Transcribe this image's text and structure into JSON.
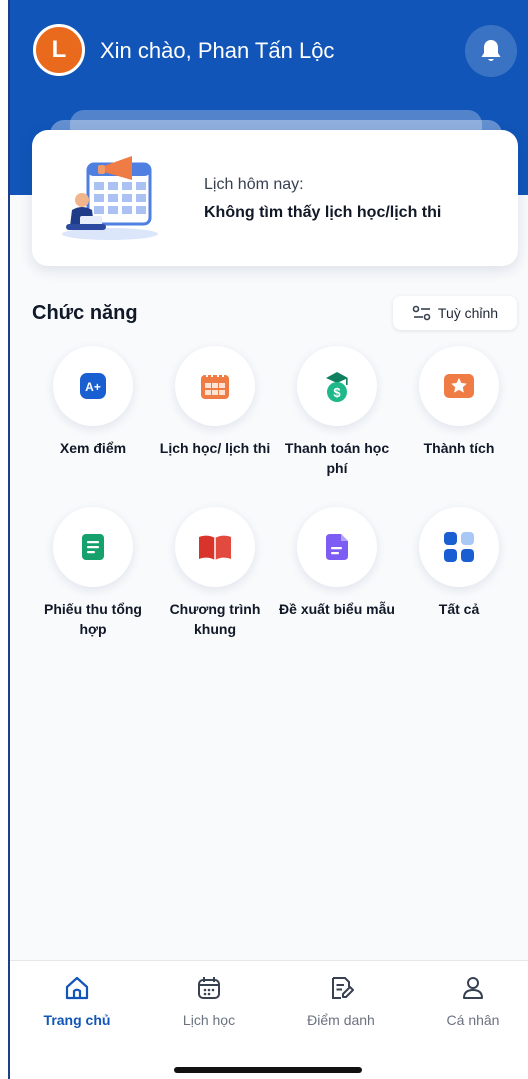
{
  "header": {
    "avatar_initial": "L",
    "greeting": "Xin chào, Phan Tấn Lộc",
    "bell_icon": "bell-icon"
  },
  "schedule_card": {
    "label": "Lịch hôm nay:",
    "value": "Không tìm thấy lịch học/lịch thi"
  },
  "features_section": {
    "title": "Chức năng",
    "customize_label": "Tuỳ chỉnh",
    "items": [
      {
        "label": "Xem điểm",
        "icon": "grade-icon",
        "color": "#1a5fd1"
      },
      {
        "label": "Lịch học/ lịch thi",
        "icon": "calendar-icon",
        "color": "#f07c45"
      },
      {
        "label": "Thanh toán học phí",
        "icon": "tuition-icon",
        "color": "#12a07a"
      },
      {
        "label": "Thành tích",
        "icon": "achievement-icon",
        "color": "#f07c45"
      },
      {
        "label": "Phiếu thu tổng hợp",
        "icon": "receipt-icon",
        "color": "#16a06b"
      },
      {
        "label": "Chương trình khung",
        "icon": "book-icon",
        "color": "#d9342b"
      },
      {
        "label": "Đề xuất biểu mẫu",
        "icon": "form-icon",
        "color": "#7c5cf2"
      },
      {
        "label": "Tất cả",
        "icon": "grid-icon",
        "color": "#1a5fd1"
      }
    ]
  },
  "bottom_nav": {
    "items": [
      {
        "label": "Trang chủ",
        "icon": "home-icon",
        "active": true
      },
      {
        "label": "Lịch học",
        "icon": "calendar-icon",
        "active": false
      },
      {
        "label": "Điểm danh",
        "icon": "attendance-icon",
        "active": false
      },
      {
        "label": "Cá nhân",
        "icon": "user-icon",
        "active": false
      }
    ]
  },
  "colors": {
    "primary": "#1155b8",
    "avatar": "#ea6a1d",
    "background": "#f8fafc"
  }
}
